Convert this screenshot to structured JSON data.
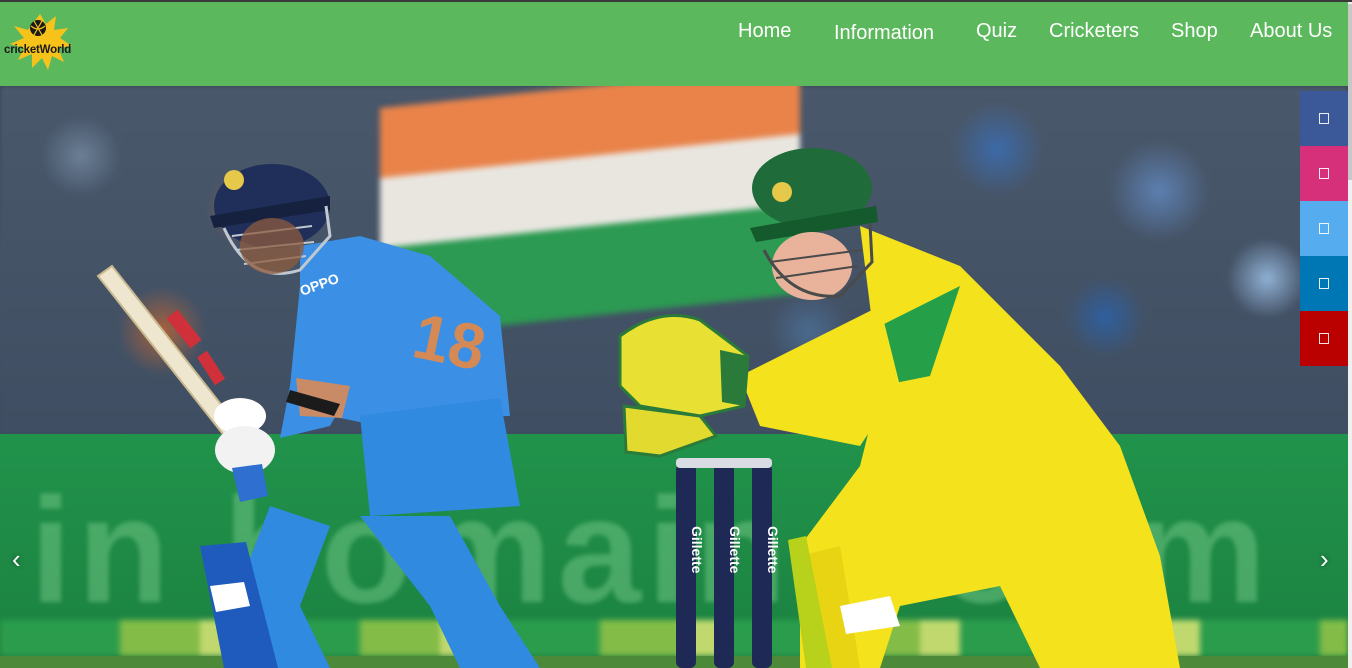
{
  "brand": {
    "name": "cricketWorld"
  },
  "nav": {
    "items": [
      {
        "label": "Home"
      },
      {
        "label": "Information"
      },
      {
        "label": "Quiz"
      },
      {
        "label": "Cricketers"
      },
      {
        "label": "Shop"
      },
      {
        "label": "About Us"
      }
    ]
  },
  "carousel": {
    "prev_label": "‹",
    "next_label": "›",
    "stump_brand": "Gillette",
    "banner_text": "in bomain boom",
    "jersey_number": "18",
    "jersey_sponsor": "OPPO"
  },
  "social": [
    {
      "icon": "facebook-icon",
      "color": "#3b5998"
    },
    {
      "icon": "instagram-icon",
      "color": "#d6307a"
    },
    {
      "icon": "twitter-icon",
      "color": "#55acee"
    },
    {
      "icon": "linkedin-icon",
      "color": "#0077b5"
    },
    {
      "icon": "youtube-icon",
      "color": "#bb0000"
    }
  ],
  "colors": {
    "navbar": "#5cb85c",
    "logo_splash": "#f7c31b"
  }
}
